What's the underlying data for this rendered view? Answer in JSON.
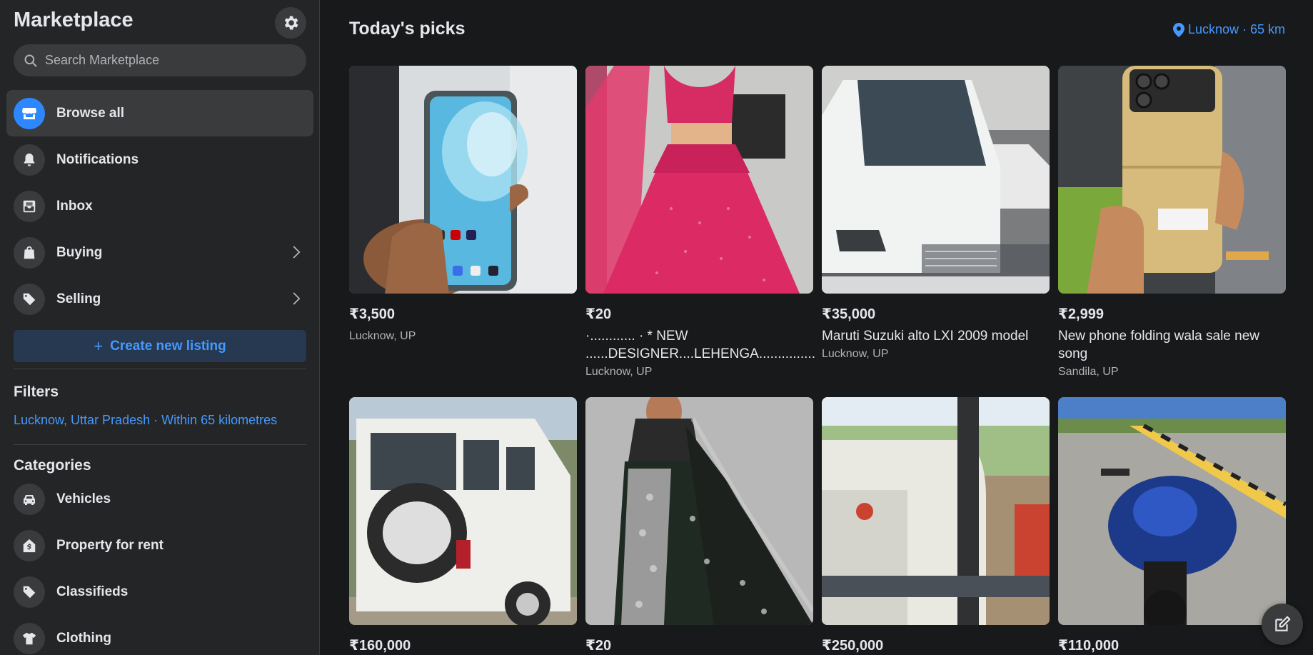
{
  "sidebar": {
    "title": "Marketplace",
    "search_placeholder": "Search Marketplace",
    "nav": [
      {
        "label": "Browse all",
        "icon": "storefront-icon"
      },
      {
        "label": "Notifications",
        "icon": "bell-icon"
      },
      {
        "label": "Inbox",
        "icon": "inbox-icon"
      },
      {
        "label": "Buying",
        "icon": "shopping-bag-icon"
      },
      {
        "label": "Selling",
        "icon": "price-tag-icon"
      }
    ],
    "create_label": "Create new listing",
    "filters_title": "Filters",
    "filter_link": "Lucknow, Uttar Pradesh · Within 65 kilometres",
    "categories_title": "Categories",
    "categories": [
      {
        "label": "Vehicles",
        "icon": "car-icon"
      },
      {
        "label": "Property for rent",
        "icon": "house-dollar-icon"
      },
      {
        "label": "Classifieds",
        "icon": "tag-icon"
      },
      {
        "label": "Clothing",
        "icon": "shirt-icon"
      }
    ]
  },
  "main": {
    "title": "Today's picks",
    "location": "Lucknow · 65 km",
    "listings": [
      {
        "price": "₹3,500",
        "title": "",
        "location": "Lucknow, UP"
      },
      {
        "price": "₹20",
        "title": "·............ · * NEW ......DESIGNER....LEHENGA...............",
        "location": "Lucknow, UP"
      },
      {
        "price": "₹35,000",
        "title": "Maruti Suzuki alto LXI 2009 model",
        "location": "Lucknow, UP"
      },
      {
        "price": "₹2,999",
        "title": "New phone folding wala sale new song",
        "location": "Sandila, UP"
      },
      {
        "price": "₹160,000",
        "title": "",
        "location": ""
      },
      {
        "price": "₹20",
        "title": "",
        "location": ""
      },
      {
        "price": "₹250,000",
        "title": "",
        "location": ""
      },
      {
        "price": "₹110,000",
        "title": "",
        "location": ""
      }
    ]
  },
  "colors": {
    "accent": "#2d88ff",
    "link": "#4599ff",
    "background": "#18191a",
    "sidebar": "#242526"
  }
}
